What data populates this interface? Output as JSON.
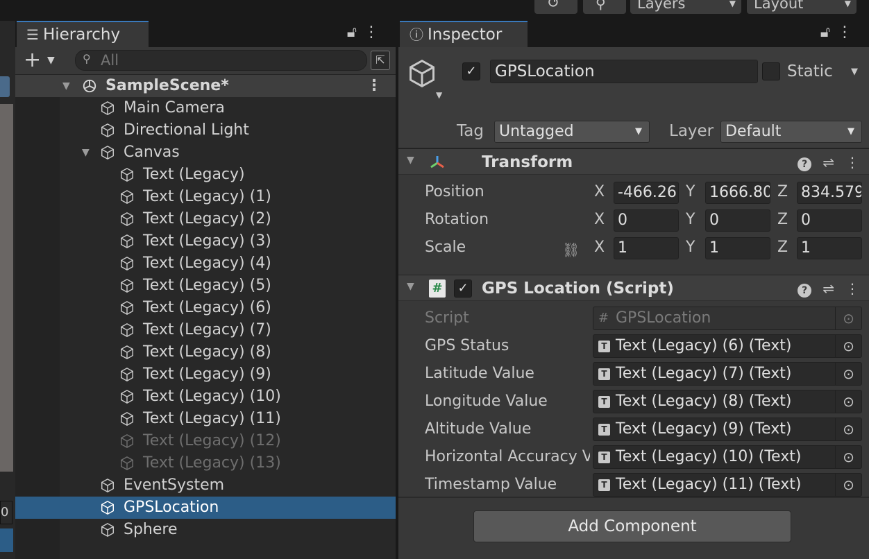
{
  "toolbar": {
    "layers_label": "Layers",
    "layout_label": "Layout"
  },
  "scene_strip": {
    "num": "0"
  },
  "hierarchy": {
    "tab_label": "Hierarchy",
    "search_placeholder": "All",
    "scene_name": "SampleScene*",
    "items": [
      {
        "label": "Main Camera"
      },
      {
        "label": "Directional Light"
      },
      {
        "label": "Canvas"
      },
      {
        "label": "Text (Legacy)"
      },
      {
        "label": "Text (Legacy) (1)"
      },
      {
        "label": "Text (Legacy) (2)"
      },
      {
        "label": "Text (Legacy) (3)"
      },
      {
        "label": "Text (Legacy) (4)"
      },
      {
        "label": "Text (Legacy) (5)"
      },
      {
        "label": "Text (Legacy) (6)"
      },
      {
        "label": "Text (Legacy) (7)"
      },
      {
        "label": "Text (Legacy) (8)"
      },
      {
        "label": "Text (Legacy) (9)"
      },
      {
        "label": "Text (Legacy) (10)"
      },
      {
        "label": "Text (Legacy) (11)"
      },
      {
        "label": "Text (Legacy) (12)"
      },
      {
        "label": "Text (Legacy) (13)"
      },
      {
        "label": "EventSystem"
      },
      {
        "label": "GPSLocation"
      },
      {
        "label": "Sphere"
      }
    ],
    "selected_item": "GPSLocation"
  },
  "inspector": {
    "tab_label": "Inspector",
    "object_name": "GPSLocation",
    "static_label": "Static",
    "tag_label": "Tag",
    "tag_value": "Untagged",
    "layer_label": "Layer",
    "layer_value": "Default",
    "transform": {
      "title": "Transform",
      "position_label": "Position",
      "rotation_label": "Rotation",
      "scale_label": "Scale",
      "axis_x": "X",
      "axis_y": "Y",
      "axis_z": "Z",
      "position": {
        "x": "-466.26",
        "y": "1666.80",
        "z": "834.579"
      },
      "rotation": {
        "x": "0",
        "y": "0",
        "z": "0"
      },
      "scale": {
        "x": "1",
        "y": "1",
        "z": "1"
      }
    },
    "script_component": {
      "title": "GPS Location (Script)",
      "script_label": "Script",
      "script_value": "GPSLocation",
      "fields": [
        {
          "label": "GPS Status",
          "value": "Text (Legacy) (6) (Text)"
        },
        {
          "label": "Latitude Value",
          "value": "Text (Legacy) (7) (Text)"
        },
        {
          "label": "Longitude Value",
          "value": "Text (Legacy) (8) (Text)"
        },
        {
          "label": "Altitude Value",
          "value": "Text (Legacy) (9) (Text)"
        },
        {
          "label": "Horizontal Accuracy V",
          "value": "Text (Legacy) (10) (Text)"
        },
        {
          "label": "Timestamp Value",
          "value": "Text (Legacy) (11) (Text)"
        }
      ]
    },
    "add_component_label": "Add Component"
  },
  "colors": {
    "selection": "#2c5d87",
    "panel": "#383838",
    "tab_accent": "#3a79bb"
  }
}
